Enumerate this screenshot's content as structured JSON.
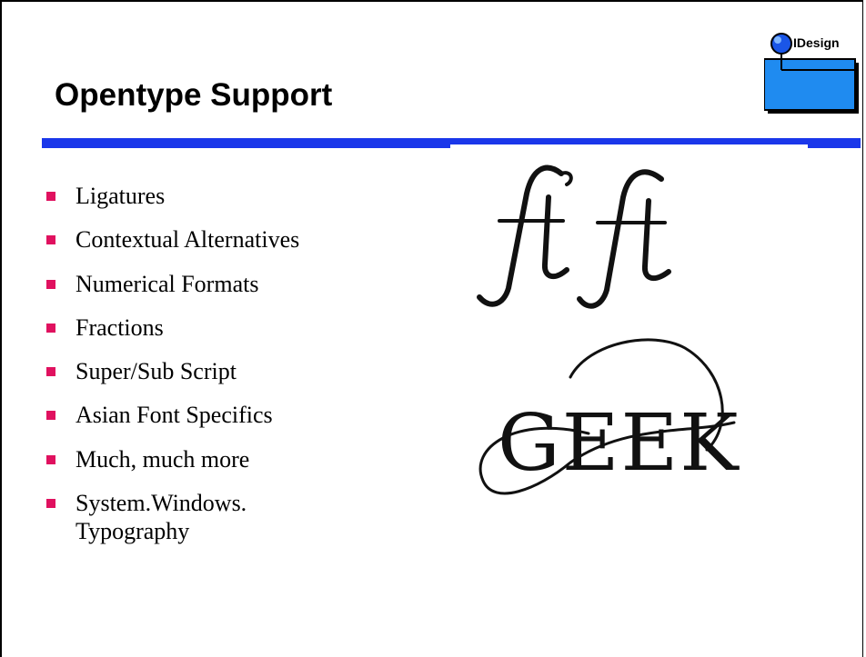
{
  "slide": {
    "title": "Opentype Support",
    "logo_text": "IDesign",
    "bullets": [
      "Ligatures",
      "Contextual Alternatives",
      "Numerical Formats",
      "Fractions",
      "Super/Sub Script",
      "Asian Font Specifics",
      "Much, much more"
    ],
    "last_bullet_lines": [
      "System.Windows.",
      "Typography"
    ],
    "illustration_text": [
      "ft",
      "ft",
      "GEEK"
    ]
  }
}
